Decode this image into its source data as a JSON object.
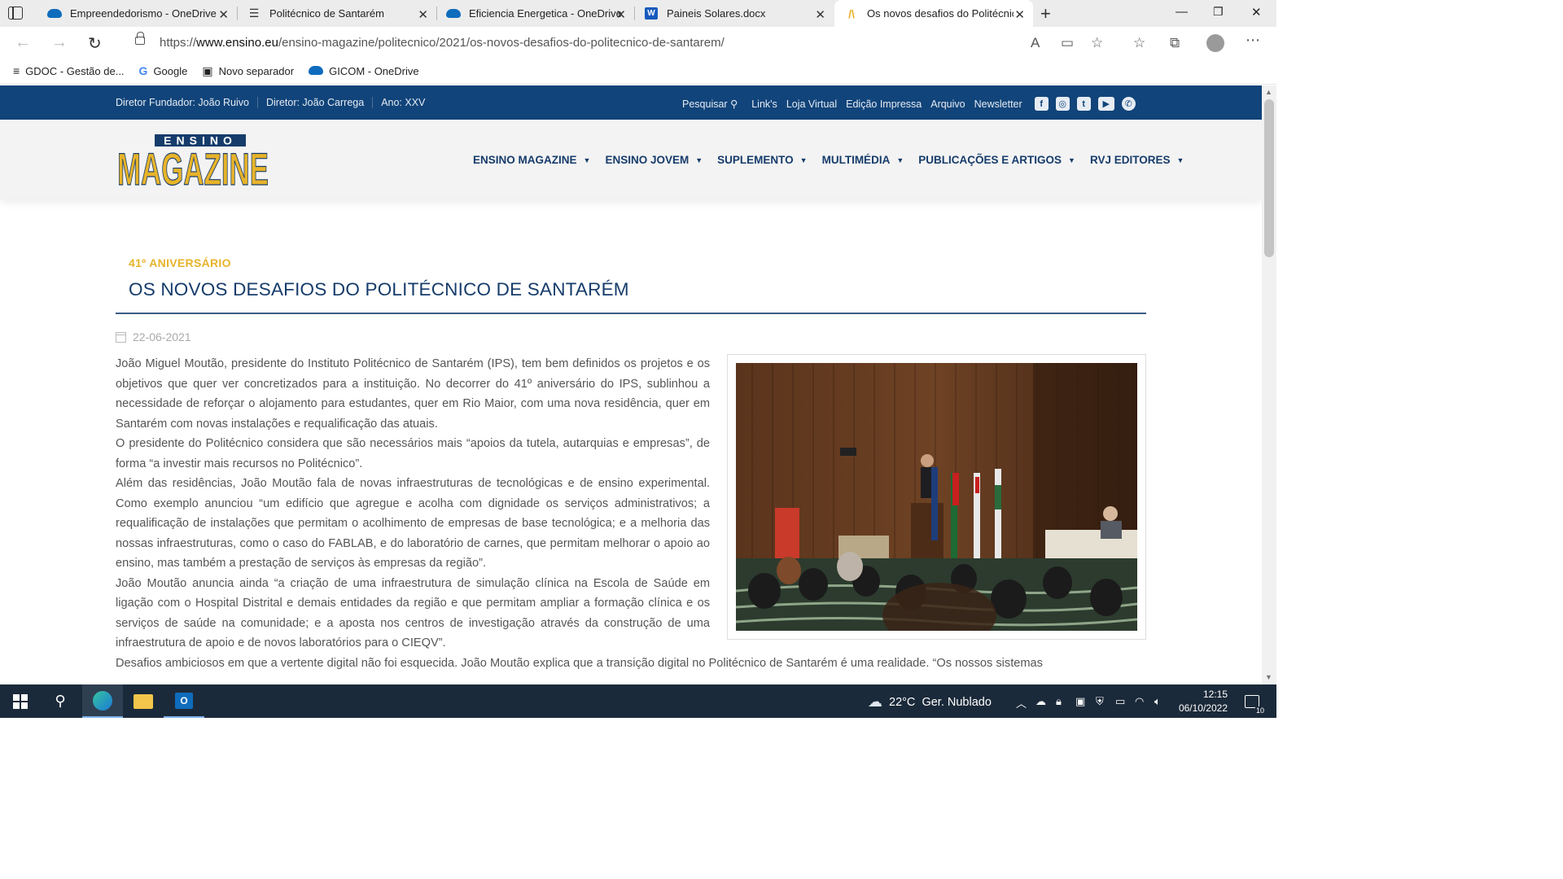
{
  "browser": {
    "tabs": [
      {
        "label": "Empreendedorismo - OneDrive",
        "icon": "onedrive-icon"
      },
      {
        "label": "Politécnico de Santarém",
        "icon": "site-icon"
      },
      {
        "label": "Eficiencia Energetica - OneDrive",
        "icon": "onedrive-icon"
      },
      {
        "label": "Paineis Solares.docx",
        "icon": "word-icon"
      },
      {
        "label": "Os novos desafios do Politécnico",
        "icon": "magazine-icon",
        "active": true
      }
    ],
    "url_prefix": "https://",
    "url_domain": "www.ensino.eu",
    "url_path": "/ensino-magazine/politecnico/2021/os-novos-desafios-do-politecnico-de-santarem/",
    "favorites": [
      {
        "label": "GDOC - Gestão de...",
        "icon": "gdoc-icon"
      },
      {
        "label": "Google",
        "icon": "google-icon"
      },
      {
        "label": "Novo separador",
        "icon": "newtab-icon"
      },
      {
        "label": "GICOM - OneDrive",
        "icon": "onedrive-icon"
      }
    ]
  },
  "site": {
    "topbar": {
      "founder": "Diretor Fundador: João Ruivo",
      "director": "Diretor: João Carrega",
      "year": "Ano: XXV",
      "search": "Pesquisar",
      "links": [
        "Link's",
        "Loja Virtual",
        "Edição Impressa",
        "Arquivo",
        "Newsletter"
      ]
    },
    "logo_top": "ENSINO",
    "logo_main": "MAGAZINE",
    "nav": [
      "ENSINO MAGAZINE",
      "ENSINO JOVEM",
      "SUPLEMENTO",
      "MULTIMÉDIA",
      "PUBLICAÇÕES E ARTIGOS",
      "RVJ EDITORES"
    ]
  },
  "article": {
    "kicker": "41º ANIVERSÁRIO",
    "title": "OS NOVOS DESAFIOS DO POLITÉCNICO DE SANTARÉM",
    "date": "22-06-2021",
    "paragraphs": [
      "João Miguel Moutão, presidente do Instituto Politécnico de Santarém (IPS), tem bem definidos os projetos e os objetivos que quer ver concretizados para a instituição. No decorrer do 41º aniversário do IPS, sublinhou a necessidade de reforçar o alojamento para estudantes, quer em Rio Maior, com uma nova residência, quer em Santarém com novas instalações e requalificação das atuais.",
      "O presidente do Politécnico considera que são necessários mais “apoios da tutela, autarquias e empresas”, de forma “a investir mais recursos no Politécnico”.",
      "Além das residências, João Moutão fala de novas infraestruturas de tecnológicas e de ensino experimental. Como exemplo anunciou “um edifício que agregue e acolha com dignidade os serviços administrativos; a requalificação de instalações que permitam o acolhimento de empresas de base tecnológica; e a melhoria das nossas infraestruturas, como o caso do FABLAB, e do laboratório de carnes, que permitam melhorar o apoio ao ensino, mas também a prestação de serviços às empresas da região”.",
      "João Moutão anuncia ainda “a criação de uma infraestrutura de simulação clínica na Escola de Saúde em ligação com o Hospital Distrital e demais entidades da região e que permitam ampliar a formação clínica e os serviços de saúde na comunidade; e a aposta nos centros de investigação através da construção de uma infraestrutura de apoio e de novos laboratórios para o CIEQV”.",
      "Desafios ambiciosos em que a vertente digital não foi esquecida. João Moutão explica que a transição digital no Politécnico de Santarém é uma realidade. “Os nossos sistemas"
    ]
  },
  "taskbar": {
    "weather": "22°C  Ger. Nublado",
    "time": "12:15",
    "date": "06/10/2022",
    "notifications": "10"
  }
}
